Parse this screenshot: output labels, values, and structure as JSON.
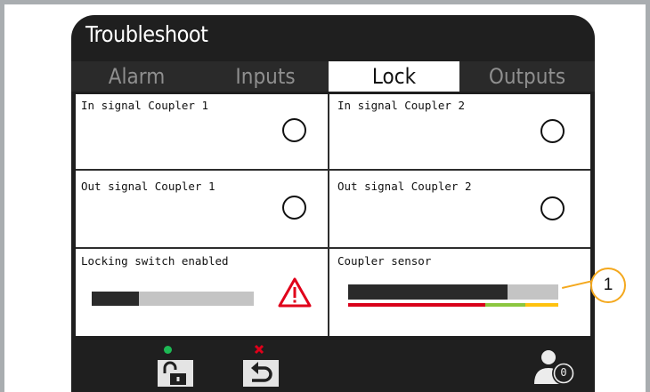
{
  "screen": {
    "title": "Troubleshoot"
  },
  "tabs": [
    {
      "label": "Alarm",
      "active": false
    },
    {
      "label": "Inputs",
      "active": false
    },
    {
      "label": "Lock",
      "active": true
    },
    {
      "label": "Outputs",
      "active": false
    }
  ],
  "cells": {
    "in_coupler_1": {
      "label": "In signal Coupler 1",
      "state": "off"
    },
    "in_coupler_2": {
      "label": "In signal Coupler 2",
      "state": "off"
    },
    "out_coupler_1": {
      "label": "Out signal Coupler 1",
      "state": "off"
    },
    "out_coupler_2": {
      "label": "Out signal Coupler 2",
      "state": "off"
    },
    "locking_switch": {
      "label": "Locking switch enabled",
      "progress": 0.29,
      "icon": "warning-icon",
      "icon_color": "#e0001a"
    },
    "coupler_sensor": {
      "label": "Coupler sensor",
      "level": 0.76,
      "scale_colors": [
        "#d9001a",
        "#8cc63f",
        "#ffc20e"
      ]
    }
  },
  "callout": {
    "label": "1",
    "color": "#f4a81d"
  },
  "bottom_bar": {
    "unlock_button": {
      "icon": "unlock-icon",
      "status_icon": "green-dot-icon",
      "status_color": "#1db954"
    },
    "back_button": {
      "icon": "back-arrow-icon",
      "status_icon": "red-x-icon",
      "status_color": "#e0001a"
    },
    "user": {
      "icon": "user-icon",
      "count": "0"
    }
  }
}
